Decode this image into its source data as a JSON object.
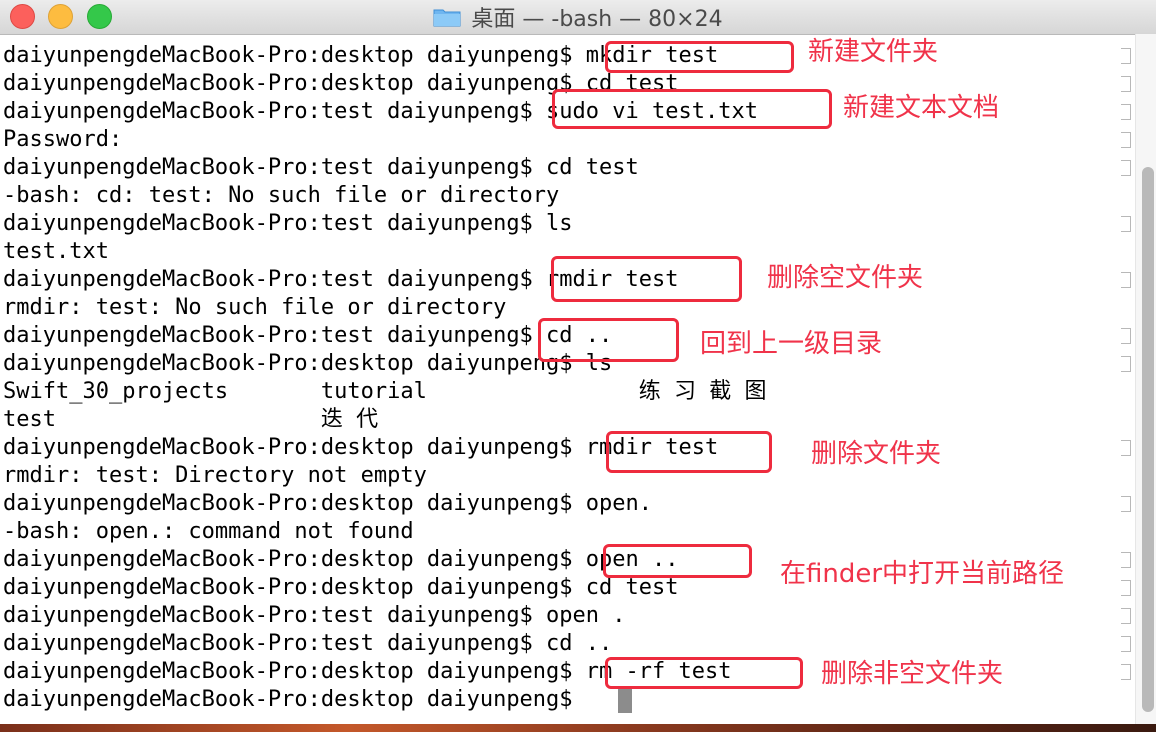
{
  "window": {
    "title": "桌面 — -bash — 80×24"
  },
  "terminal": {
    "lines": [
      "daiyunpengdeMacBook-Pro:desktop daiyunpeng$ mkdir test",
      "daiyunpengdeMacBook-Pro:desktop daiyunpeng$ cd test",
      "daiyunpengdeMacBook-Pro:test daiyunpeng$ sudo vi test.txt",
      "Password:",
      "daiyunpengdeMacBook-Pro:test daiyunpeng$ cd test",
      "-bash: cd: test: No such file or directory",
      "daiyunpengdeMacBook-Pro:test daiyunpeng$ ls",
      "test.txt",
      "daiyunpengdeMacBook-Pro:test daiyunpeng$ rmdir test",
      "rmdir: test: No such file or directory",
      "daiyunpengdeMacBook-Pro:test daiyunpeng$ cd ..",
      "daiyunpengdeMacBook-Pro:desktop daiyunpeng$ ls",
      "Swift_30_projects       tutorial                练 习 截 图",
      "test                    迭 代",
      "daiyunpengdeMacBook-Pro:desktop daiyunpeng$ rmdir test",
      "rmdir: test: Directory not empty",
      "daiyunpengdeMacBook-Pro:desktop daiyunpeng$ open.",
      "-bash: open.: command not found",
      "daiyunpengdeMacBook-Pro:desktop daiyunpeng$ open ..",
      "daiyunpengdeMacBook-Pro:desktop daiyunpeng$ cd test",
      "daiyunpengdeMacBook-Pro:test daiyunpeng$ open .",
      "daiyunpengdeMacBook-Pro:test daiyunpeng$ cd ..",
      "daiyunpengdeMacBook-Pro:desktop daiyunpeng$ rm -rf test",
      "daiyunpengdeMacBook-Pro:desktop daiyunpeng$ "
    ]
  },
  "annotations": [
    "新建文件夹",
    "新建文本文档",
    "删除空文件夹",
    "回到上一级目录",
    "删除文件夹",
    "在finder中打开当前路径",
    "删除非空文件夹"
  ],
  "colors": {
    "annotation": "#ee2b3e",
    "text": "#000000"
  }
}
